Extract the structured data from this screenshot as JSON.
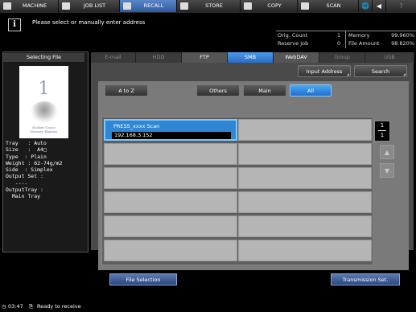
{
  "top_tabs": [
    {
      "label": "MACHINE"
    },
    {
      "label": "JOB LIST"
    },
    {
      "label": "RECALL"
    },
    {
      "label": "STORE"
    },
    {
      "label": "COPY"
    },
    {
      "label": "SCAN"
    }
  ],
  "top_icons": {
    "globe": "🌐",
    "volume": "◀",
    "help": "?"
  },
  "message": {
    "icon": "i",
    "text": "Please select or manually enter address"
  },
  "counter": {
    "orig_count_label": "Orig. Count",
    "orig_count_value": "1",
    "memory_label": "Memory",
    "memory_value": "99.960%",
    "reserve_job_label": "Reserve Job",
    "reserve_job_value": "0",
    "file_amount_label": "File Amount",
    "file_amount_value": "98.820%"
  },
  "left_panel": {
    "title": "Selecting File",
    "thumbnail": {
      "number": "1",
      "caption_line1": "Mother Goose",
      "caption_line2": "Nursery Rhymes"
    },
    "specs": "Tray   : Auto\nSize   :  A4□\nType  : Plain\nWeight : 62-74g/m2\nSide  : Simplex\nOutput Set :\n   ----\nOutputTray :\n  Main Tray"
  },
  "dest_tabs": [
    {
      "label": "E-mail"
    },
    {
      "label": "HDD"
    },
    {
      "label": "FTP"
    },
    {
      "label": "SMB"
    },
    {
      "label": "WebDAV"
    },
    {
      "label": "Group"
    },
    {
      "label": "USB"
    }
  ],
  "buttons": {
    "input_address": "Input Address",
    "search": "Search",
    "a_to_z": "A to Z",
    "others": "Others",
    "main": "Main",
    "all": "All",
    "file_selection": "File Selection",
    "transmission_set": "Transmission Set."
  },
  "address_list": [
    {
      "name": "PRESS_xxxx Scan",
      "address": "192.168.3.152"
    }
  ],
  "pager": {
    "current": "1",
    "total": "1"
  },
  "status": {
    "time": "03:47",
    "text": "Ready to receive"
  }
}
